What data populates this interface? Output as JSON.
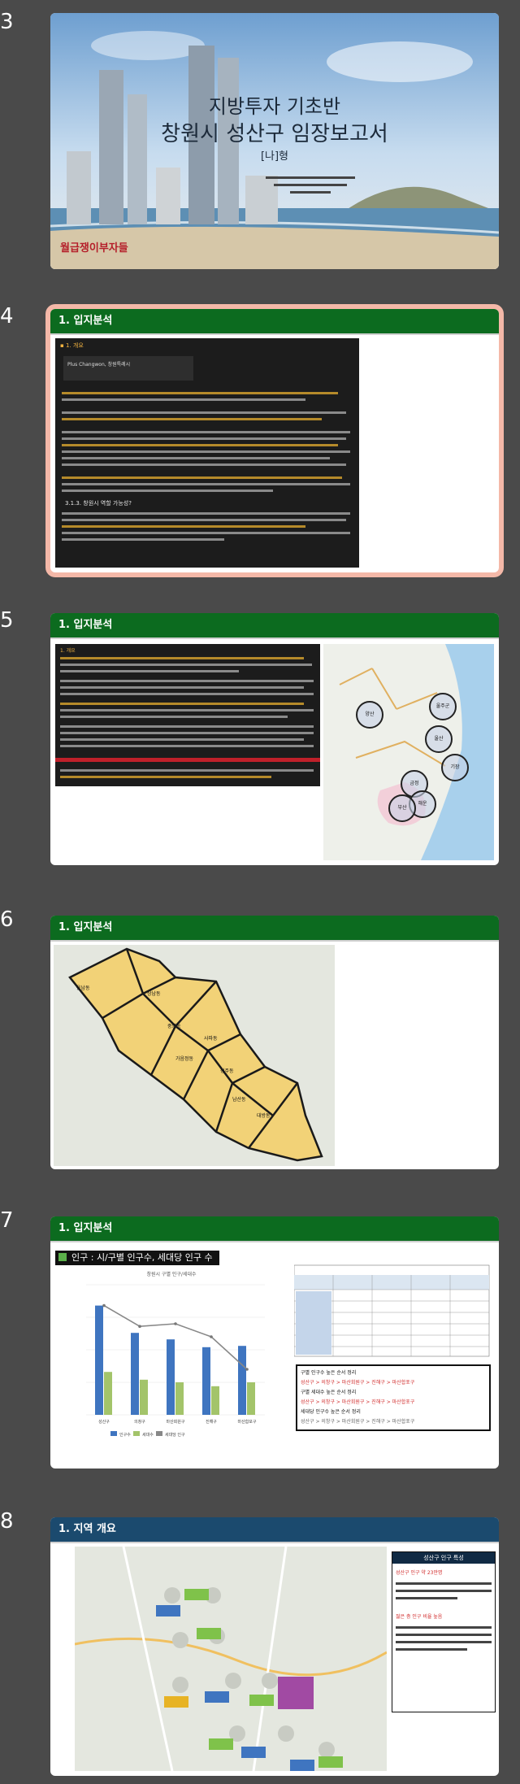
{
  "slides": [
    {
      "number": "3"
    },
    {
      "number": "4"
    },
    {
      "number": "5"
    },
    {
      "number": "6"
    },
    {
      "number": "7"
    },
    {
      "number": "8"
    }
  ],
  "slide3": {
    "title_line1": "지방투자 기초반",
    "title_line2": "창원시 성산구 임장보고서",
    "subtitle": "[나]형",
    "brand": "월급쟁이부자들",
    "brand_accent": "부자들"
  },
  "slide4": {
    "header": "1. 입지분석",
    "card_title": "Plus Changwon, 창원특례시",
    "section_label": "3.1.3. 창원시 역할 가능성?"
  },
  "slide5": {
    "header": "1. 입지분석",
    "section_label": "1. 개요",
    "labels": [
      "양산",
      "울주군",
      "울산",
      "기장",
      "금정",
      "해운",
      "부산"
    ]
  },
  "slide6": {
    "header": "1. 입지분석",
    "districts": [
      "웅남동",
      "상남동",
      "중앙동",
      "사파동",
      "가음정동",
      "성주동",
      "남산동",
      "대방동"
    ]
  },
  "slide7": {
    "header": "1. 입지분석",
    "section_title": "인구 : 시/구별 인구수, 세대당 인구 수",
    "chart_title": "창원시 구별 인구/세대수",
    "legend": [
      "인구수",
      "세대수",
      "세대당 인구"
    ],
    "note_lines": [
      "구별 인구수 높은 순서 정리",
      "성산구 > 의창구 > 마산회원구 > 진해구 > 마산합포구",
      "구별 세대수 높은 순서 정리",
      "성산구 > 의창구 > 마산회원구 > 진해구 > 마산합포구",
      "세대당 인구수 높은 순서 정리",
      "성산구 > 의창구 > 마산회원구 > 진해구 > 마산합포구"
    ]
  },
  "slide8": {
    "header": "1. 지역 개요",
    "box_title": "성산구 인구 특성",
    "box_red1": "성산구 인구 약 23만명",
    "box_red2": "젊은 층 인구 비율 높음"
  },
  "chart_data": {
    "type": "bar",
    "categories": [
      "성산구",
      "의창구",
      "마산회원구",
      "진해구",
      "마산합포구"
    ],
    "series": [
      {
        "name": "인구수",
        "values": [
          0.84,
          0.63,
          0.58,
          0.52,
          0.53
        ]
      },
      {
        "name": "세대수",
        "values": [
          0.33,
          0.27,
          0.25,
          0.22,
          0.25
        ]
      },
      {
        "name": "세대당 인구",
        "values": [
          0.84,
          0.68,
          0.7,
          0.6,
          0.35
        ]
      }
    ],
    "ylim": [
      0,
      1
    ]
  },
  "colors": {
    "green_header": "#0c6b1f",
    "blue_header": "#1b4a6e",
    "selected_border": "#f4b8a8",
    "district_fill": "#f2d277",
    "bar_blue": "#3f75c0",
    "bar_green": "#a3c46a"
  }
}
